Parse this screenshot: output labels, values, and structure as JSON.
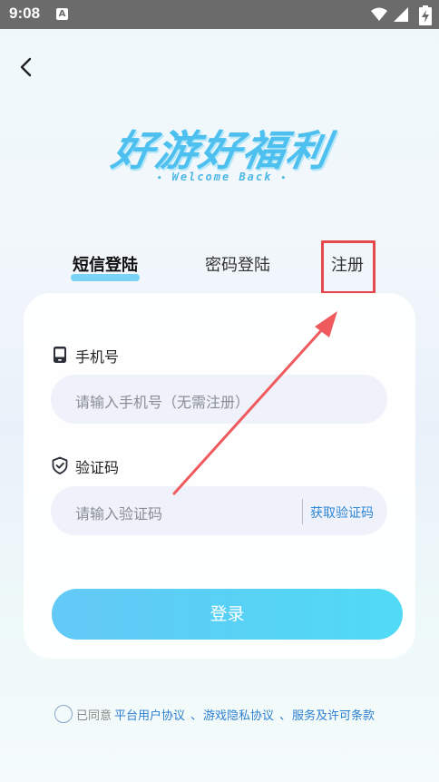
{
  "status_bar": {
    "time": "9:08",
    "notification_icon": "A",
    "icons": [
      "wifi-icon",
      "signal-icon",
      "battery-charging-icon"
    ]
  },
  "header": {
    "back_icon": "chevron-left-icon"
  },
  "logo": {
    "title": "好游好福利",
    "subtitle": "Welcome Back",
    "dot": "•"
  },
  "tabs": [
    {
      "label": "短信登陆",
      "active": true
    },
    {
      "label": "密码登陆",
      "active": false
    },
    {
      "label": "注册",
      "active": false
    }
  ],
  "form": {
    "phone": {
      "label": "手机号",
      "icon": "phone-icon",
      "placeholder": "请输入手机号（无需注册）",
      "value": ""
    },
    "code": {
      "label": "验证码",
      "icon": "shield-check-icon",
      "placeholder": "请输入验证码",
      "value": "",
      "get_code_label": "获取验证码"
    },
    "login_label": "登录"
  },
  "agreement": {
    "checked": false,
    "prefix": "已同意",
    "links": [
      "平台用户协议",
      "游戏隐私协议",
      "服务及许可条款"
    ],
    "separator": "、"
  },
  "colors": {
    "accent": "#4dc0ef",
    "link": "#2e7fd0",
    "annotation_red": "#e5484d"
  }
}
